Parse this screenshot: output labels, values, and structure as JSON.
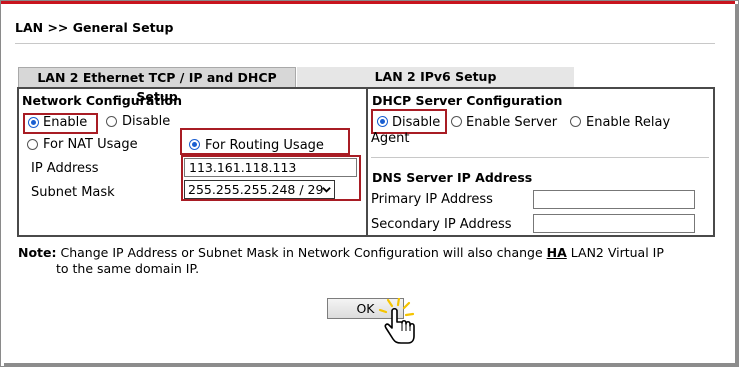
{
  "page": {
    "title": "LAN >> General Setup"
  },
  "tabs": [
    {
      "label": "LAN 2 Ethernet TCP / IP and DHCP Setup",
      "active": true
    },
    {
      "label": "LAN 2 IPv6 Setup",
      "active": false
    }
  ],
  "network": {
    "title": "Network Configuration",
    "enable_label": "Enable",
    "disable_label": "Disable",
    "nat_label": "For NAT Usage",
    "routing_label": "For Routing Usage",
    "ip_label": "IP Address",
    "ip_value": "113.161.118.113",
    "mask_label": "Subnet Mask",
    "mask_value": "255.255.255.248 / 29",
    "enabled": true,
    "usage": "routing"
  },
  "dhcp": {
    "title": "DHCP Server Configuration",
    "disable_label": "Disable",
    "server_label": "Enable Server",
    "relay_label": "Enable Relay",
    "relay_label_cont": "Agent",
    "selected": "disable"
  },
  "dns": {
    "title": "DNS Server IP Address",
    "primary_label": "Primary IP Address",
    "primary_value": "",
    "secondary_label": "Secondary IP Address",
    "secondary_value": ""
  },
  "note": {
    "prefix": "Note:",
    "text1": "Change IP Address or Subnet Mask in Network Configuration will also change",
    "ha": "HA",
    "text2": "LAN2 Virtual IP",
    "text3": "to the same domain IP."
  },
  "ok_label": "OK",
  "colors": {
    "accent_red": "#c8141e",
    "highlight_red": "#a81c24",
    "radio_blue": "#1a5fd1"
  },
  "icons": {
    "cursor": "hand-pointer-icon",
    "select_arrow": "chevron-down-icon"
  }
}
